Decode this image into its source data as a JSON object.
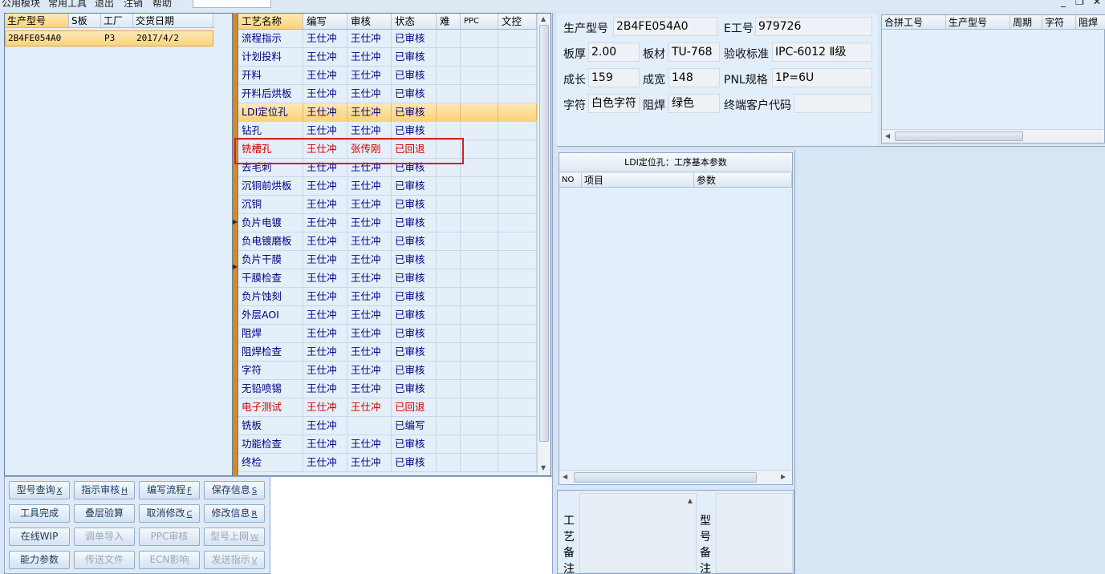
{
  "menu": {
    "items": [
      "公用模块",
      "常用工具",
      "退出",
      "注销",
      "帮助"
    ],
    "window_controls": [
      "_",
      "❐",
      "✕"
    ]
  },
  "model_list": {
    "columns": [
      "生产型号",
      "S板",
      "工厂",
      "交货日期"
    ],
    "rows": [
      {
        "model": "2B4FE054A0",
        "s": "",
        "factory": "P3",
        "date": "2017/4/2"
      }
    ]
  },
  "process_grid": {
    "columns": [
      "工艺名称",
      "编写",
      "审核",
      "状态",
      "难",
      "PPC",
      "文控"
    ],
    "rows": [
      {
        "name": "流程指示",
        "writer": "王仕冲",
        "reviewer": "王仕冲",
        "status": "已审核"
      },
      {
        "name": "计划投料",
        "writer": "王仕冲",
        "reviewer": "王仕冲",
        "status": "已审核"
      },
      {
        "name": "开料",
        "writer": "王仕冲",
        "reviewer": "王仕冲",
        "status": "已审核"
      },
      {
        "name": "开料后烘板",
        "writer": "王仕冲",
        "reviewer": "王仕冲",
        "status": "已审核"
      },
      {
        "name": "LDI定位孔",
        "writer": "王仕冲",
        "reviewer": "王仕冲",
        "status": "已审核",
        "selected": true
      },
      {
        "name": "钻孔",
        "writer": "王仕冲",
        "reviewer": "王仕冲",
        "status": "已审核"
      },
      {
        "name": "铣槽孔",
        "writer": "王仕冲",
        "reviewer": "张传刚",
        "status": "已回退",
        "returned": true
      },
      {
        "name": "去毛刺",
        "writer": "王仕冲",
        "reviewer": "王仕冲",
        "status": "已审核"
      },
      {
        "name": "沉铜前烘板",
        "writer": "王仕冲",
        "reviewer": "王仕冲",
        "status": "已审核"
      },
      {
        "name": "沉铜",
        "writer": "王仕冲",
        "reviewer": "王仕冲",
        "status": "已审核"
      },
      {
        "name": "负片电镀",
        "writer": "王仕冲",
        "reviewer": "王仕冲",
        "status": "已审核"
      },
      {
        "name": "负电镀磨板",
        "writer": "王仕冲",
        "reviewer": "王仕冲",
        "status": "已审核"
      },
      {
        "name": "负片干膜",
        "writer": "王仕冲",
        "reviewer": "王仕冲",
        "status": "已审核"
      },
      {
        "name": "干膜检查",
        "writer": "王仕冲",
        "reviewer": "王仕冲",
        "status": "已审核"
      },
      {
        "name": "负片蚀刻",
        "writer": "王仕冲",
        "reviewer": "王仕冲",
        "status": "已审核"
      },
      {
        "name": "外层AOI",
        "writer": "王仕冲",
        "reviewer": "王仕冲",
        "status": "已审核"
      },
      {
        "name": "阻焊",
        "writer": "王仕冲",
        "reviewer": "王仕冲",
        "status": "已审核"
      },
      {
        "name": "阻焊检查",
        "writer": "王仕冲",
        "reviewer": "王仕冲",
        "status": "已审核"
      },
      {
        "name": "字符",
        "writer": "王仕冲",
        "reviewer": "王仕冲",
        "status": "已审核"
      },
      {
        "name": "无铅喷锡",
        "writer": "王仕冲",
        "reviewer": "王仕冲",
        "status": "已审核"
      },
      {
        "name": "电子测试",
        "writer": "王仕冲",
        "reviewer": "王仕冲",
        "status": "已回退",
        "returned": true
      },
      {
        "name": "铣板",
        "writer": "王仕冲",
        "reviewer": "",
        "status": "已编写"
      },
      {
        "name": "功能检查",
        "writer": "王仕冲",
        "reviewer": "王仕冲",
        "status": "已审核"
      },
      {
        "name": "终检",
        "writer": "王仕冲",
        "reviewer": "王仕冲",
        "status": "已审核"
      }
    ]
  },
  "buttons": [
    {
      "label": "型号查询",
      "key": "X",
      "enabled": true
    },
    {
      "label": "指示审核",
      "key": "H",
      "enabled": true
    },
    {
      "label": "编写流程",
      "key": "F",
      "enabled": true
    },
    {
      "label": "保存信息",
      "key": "S",
      "enabled": true
    },
    {
      "label": "工具完成",
      "key": "",
      "enabled": true
    },
    {
      "label": "叠层验算",
      "key": "",
      "enabled": true
    },
    {
      "label": "取消修改",
      "key": "C",
      "enabled": true
    },
    {
      "label": "修改信息",
      "key": "R",
      "enabled": true
    },
    {
      "label": "在线WIP",
      "key": "",
      "enabled": true
    },
    {
      "label": "调单导入",
      "key": "",
      "enabled": false
    },
    {
      "label": "PPC审核",
      "key": "",
      "enabled": false
    },
    {
      "label": "型号上网",
      "key": "W",
      "enabled": false
    },
    {
      "label": "能力参数",
      "key": "",
      "enabled": true
    },
    {
      "label": "传送文件",
      "key": "",
      "enabled": false
    },
    {
      "label": "ECN影响",
      "key": "",
      "enabled": false
    },
    {
      "label": "发送指示",
      "key": "V",
      "enabled": false
    }
  ],
  "info": {
    "model_label": "生产型号",
    "model_value": "2B4FE054A0",
    "e_label": "E工号",
    "e_value": "979726",
    "thickness_label": "板厚",
    "thickness_value": "2.00",
    "material_label": "板材",
    "material_value": "TU-768",
    "standard_label": "验收标准",
    "standard_value": "IPC-6012 Ⅱ级",
    "length_label": "成长",
    "length_value": "159",
    "width_label": "成宽",
    "width_value": "148",
    "pnl_label": "PNL规格",
    "pnl_value": "1P=6U",
    "char_label": "字符",
    "char_value": "白色字符",
    "mask_label": "阻焊",
    "mask_value": "绿色",
    "customer_label": "终端客户代码",
    "customer_value": ""
  },
  "merge_table": {
    "columns": [
      "合拼工号",
      "生产型号",
      "周期",
      "字符",
      "阻焊"
    ]
  },
  "param_table": {
    "title": "LDI定位孔：工序基本参数",
    "columns": [
      "NO",
      "项目",
      "参数"
    ]
  },
  "remarks": {
    "process_label": "工艺备注",
    "model_label": "型号备注"
  }
}
